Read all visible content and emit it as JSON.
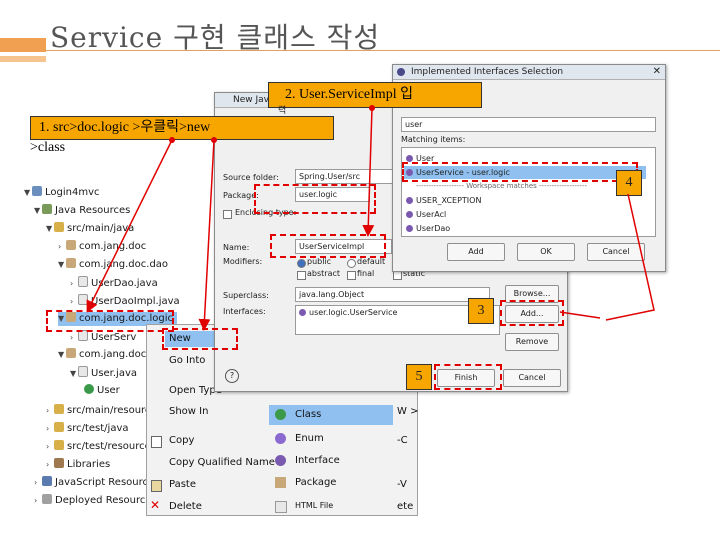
{
  "slide": {
    "title": "Service 구현 클래스 작성"
  },
  "callouts": {
    "step1_line1": "1. src>doc.logic >우클릭>new",
    "step1_line2": ">class",
    "step2": "2. User.ServiceImpl 입",
    "step2_cont": "력",
    "step3": "3",
    "step4": "4",
    "step5": "5"
  },
  "project_tree": {
    "items": [
      {
        "label": "Login4mvc"
      },
      {
        "label": "Java Resources"
      },
      {
        "label": "src/main/java"
      },
      {
        "label": "com.jang.doc"
      },
      {
        "label": "com.jang.doc.dao"
      },
      {
        "label": "UserDao.java"
      },
      {
        "label": "UserDaoImpl.java"
      },
      {
        "label": "com.jang.doc.logic"
      },
      {
        "label": "UserServ"
      },
      {
        "label": "com.jang.doc.m"
      },
      {
        "label": "User.java"
      },
      {
        "label": "User"
      },
      {
        "label": "src/main/resources"
      },
      {
        "label": "src/test/java"
      },
      {
        "label": "src/test/resources"
      },
      {
        "label": "Libraries"
      },
      {
        "label": "JavaScript Resources"
      },
      {
        "label": "Deployed Resources"
      }
    ]
  },
  "context_menu": {
    "items": [
      "New",
      "Go Into",
      "Open Type",
      "Show In",
      "Copy",
      "Copy Qualified Name",
      "Paste",
      "Delete"
    ],
    "shortcuts": {
      "show_in": "W >",
      "copy": "-C",
      "paste": "-V",
      "delete": "ete"
    }
  },
  "submenu": {
    "items": [
      "Class",
      "Enum",
      "Interface",
      "Package",
      "HTML File"
    ]
  },
  "new_class_dialog": {
    "title": "New Java C",
    "source_folder_label": "Source folder:",
    "source_folder_value": "Spring.User/src",
    "package_label": "Package:",
    "package_value": "user.logic",
    "enclosing_label": "Enclosing type:",
    "name_label": "Name:",
    "name_value": "UserServiceImpl",
    "modifiers_label": "Modifiers:",
    "mod_public": "public",
    "mod_default": "default",
    "mod_abstract": "abstract",
    "mod_final": "final",
    "mod_static": "static",
    "superclass_label": "Superclass:",
    "superclass_value": "java.lang.Object",
    "interfaces_label": "Interfaces:",
    "interfaces_value": "user.logic.UserService",
    "browse": "Browse...",
    "add": "Add...",
    "remove": "Remove",
    "finish": "Finish",
    "cancel": "Cancel"
  },
  "interfaces_dialog": {
    "title": "Implemented Interfaces Selection",
    "search_value": "user",
    "matching_label": "Matching items:",
    "items": [
      "User",
      "UserService - user.logic",
      "------------------- Workspace matches -------------------",
      "USER_XCEPTION",
      "UserAcl",
      "UserDao"
    ],
    "add": "Add",
    "ok": "OK",
    "cancel": "Cancel"
  },
  "colors": {
    "callout": "#f7a600",
    "arrow": "#e00000",
    "highlight": "#8fc0f0"
  }
}
